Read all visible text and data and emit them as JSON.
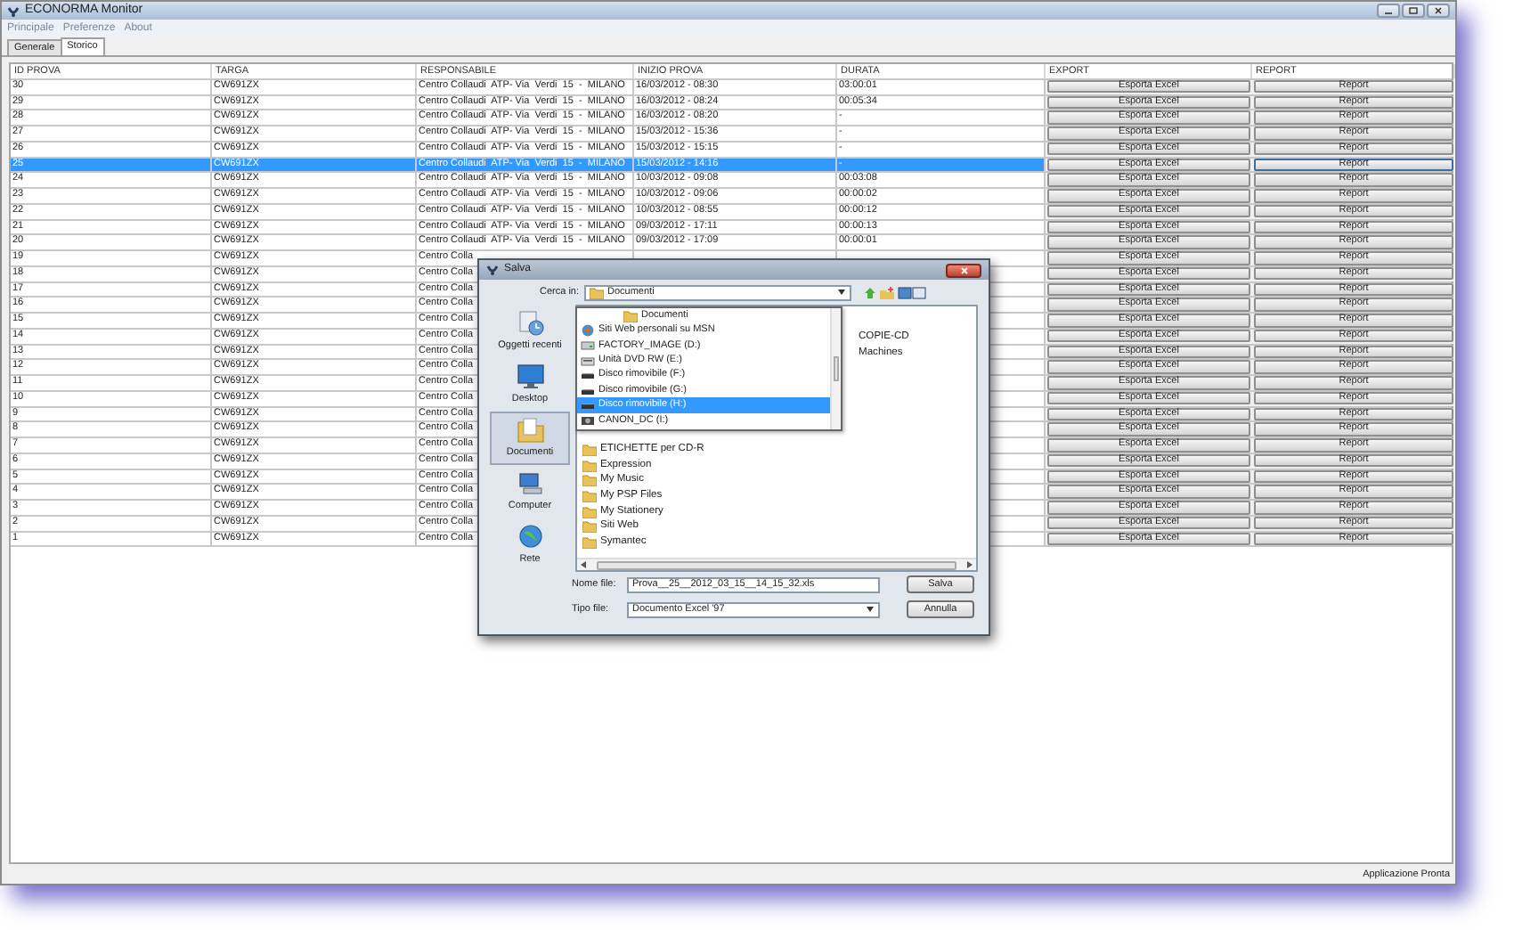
{
  "window": {
    "title": "ECONORMA Monitor"
  },
  "menu": [
    "Principale",
    "Preferenze",
    "About"
  ],
  "tabs": [
    {
      "label": "Generale",
      "selected": false
    },
    {
      "label": "Storico",
      "selected": true
    }
  ],
  "table": {
    "columns": [
      "ID PROVA",
      "TARGA",
      "RESPONSABILE",
      "INIZIO PROVA",
      "DURATA",
      "EXPORT",
      "REPORT"
    ],
    "rows": [
      {
        "id": "30",
        "targa": "CW691ZX",
        "responsabile": "Centro Collaudi  ATP- Via  Verdi  15  -  MILANO",
        "inizio": "16/03/2012 - 08:30",
        "durata": "03:00:01",
        "export": "Esporta Excel",
        "report": "Report",
        "selected": false
      },
      {
        "id": "29",
        "targa": "CW691ZX",
        "responsabile": "Centro Collaudi  ATP- Via  Verdi  15  -  MILANO",
        "inizio": "16/03/2012 - 08:24",
        "durata": "00:05:34",
        "export": "Esporta Excel",
        "report": "Report",
        "selected": false
      },
      {
        "id": "28",
        "targa": "CW691ZX",
        "responsabile": "Centro Collaudi  ATP- Via  Verdi  15  -  MILANO",
        "inizio": "16/03/2012 - 08:20",
        "durata": "-",
        "export": "Esporta Excel",
        "report": "Report",
        "selected": false
      },
      {
        "id": "27",
        "targa": "CW691ZX",
        "responsabile": "Centro Collaudi  ATP- Via  Verdi  15  -  MILANO",
        "inizio": "15/03/2012 - 15:36",
        "durata": "-",
        "export": "Esporta Excel",
        "report": "Report",
        "selected": false
      },
      {
        "id": "26",
        "targa": "CW691ZX",
        "responsabile": "Centro Collaudi  ATP- Via  Verdi  15  -  MILANO",
        "inizio": "15/03/2012 - 15:15",
        "durata": "-",
        "export": "Esporta Excel",
        "report": "Report",
        "selected": false
      },
      {
        "id": "25",
        "targa": "CW691ZX",
        "responsabile": "Centro Collaudi  ATP- Via  Verdi  15  -  MILANO",
        "inizio": "15/03/2012 - 14:16",
        "durata": "-",
        "export": "Esporta Excel",
        "report": "Report",
        "selected": true
      },
      {
        "id": "24",
        "targa": "CW691ZX",
        "responsabile": "Centro Collaudi  ATP- Via  Verdi  15  -  MILANO",
        "inizio": "10/03/2012 - 09:08",
        "durata": "00:03:08",
        "export": "Esporta Excel",
        "report": "Report",
        "selected": false
      },
      {
        "id": "23",
        "targa": "CW691ZX",
        "responsabile": "Centro Collaudi  ATP- Via  Verdi  15  -  MILANO",
        "inizio": "10/03/2012 - 09:06",
        "durata": "00:00:02",
        "export": "Esporta Excel",
        "report": "Report",
        "selected": false
      },
      {
        "id": "22",
        "targa": "CW691ZX",
        "responsabile": "Centro Collaudi  ATP- Via  Verdi  15  -  MILANO",
        "inizio": "10/03/2012 - 08:55",
        "durata": "00:00:12",
        "export": "Esporta Excel",
        "report": "Report",
        "selected": false
      },
      {
        "id": "21",
        "targa": "CW691ZX",
        "responsabile": "Centro Collaudi  ATP- Via  Verdi  15  -  MILANO",
        "inizio": "09/03/2012 - 17:11",
        "durata": "00:00:13",
        "export": "Esporta Excel",
        "report": "Report",
        "selected": false
      },
      {
        "id": "20",
        "targa": "CW691ZX",
        "responsabile": "Centro Collaudi  ATP- Via  Verdi  15  -  MILANO",
        "inizio": "09/03/2012 - 17:09",
        "durata": "00:00:01",
        "export": "Esporta Excel",
        "report": "Report",
        "selected": false
      },
      {
        "id": "19",
        "targa": "CW691ZX",
        "responsabile": "Centro Colla",
        "export": "Esporta Excel",
        "report": "Report",
        "selected": false
      },
      {
        "id": "18",
        "targa": "CW691ZX",
        "responsabile": "Centro Colla",
        "export": "Esporta Excel",
        "report": "Report",
        "selected": false
      },
      {
        "id": "17",
        "targa": "CW691ZX",
        "responsabile": "Centro Colla",
        "export": "Esporta Excel",
        "report": "Report",
        "selected": false
      },
      {
        "id": "16",
        "targa": "CW691ZX",
        "responsabile": "Centro Colla",
        "export": "Esporta Excel",
        "report": "Report",
        "selected": false
      },
      {
        "id": "15",
        "targa": "CW691ZX",
        "responsabile": "Centro Colla",
        "export": "Esporta Excel",
        "report": "Report",
        "selected": false
      },
      {
        "id": "14",
        "targa": "CW691ZX",
        "responsabile": "Centro Colla",
        "export": "Esporta Excel",
        "report": "Report",
        "selected": false
      },
      {
        "id": "13",
        "targa": "CW691ZX",
        "responsabile": "Centro Colla",
        "export": "Esporta Excel",
        "report": "Report",
        "selected": false
      },
      {
        "id": "12",
        "targa": "CW691ZX",
        "responsabile": "Centro Colla",
        "export": "Esporta Excel",
        "report": "Report",
        "selected": false
      },
      {
        "id": "11",
        "targa": "CW691ZX",
        "responsabile": "Centro Colla",
        "export": "Esporta Excel",
        "report": "Report",
        "selected": false
      },
      {
        "id": "10",
        "targa": "CW691ZX",
        "responsabile": "Centro Colla",
        "export": "Esporta Excel",
        "report": "Report",
        "selected": false
      },
      {
        "id": "9",
        "targa": "CW691ZX",
        "responsabile": "Centro Colla",
        "export": "Esporta Excel",
        "report": "Report",
        "selected": false
      },
      {
        "id": "8",
        "targa": "CW691ZX",
        "responsabile": "Centro Colla",
        "export": "Esporta Excel",
        "report": "Report",
        "selected": false
      },
      {
        "id": "7",
        "targa": "CW691ZX",
        "responsabile": "Centro Colla",
        "export": "Esporta Excel",
        "report": "Report",
        "selected": false
      },
      {
        "id": "6",
        "targa": "CW691ZX",
        "responsabile": "Centro Colla",
        "export": "Esporta Excel",
        "report": "Report",
        "selected": false
      },
      {
        "id": "5",
        "targa": "CW691ZX",
        "responsabile": "Centro Colla",
        "export": "Esporta Excel",
        "report": "Report",
        "selected": false
      },
      {
        "id": "4",
        "targa": "CW691ZX",
        "responsabile": "Centro Colla",
        "export": "Esporta Excel",
        "report": "Report",
        "selected": false
      },
      {
        "id": "3",
        "targa": "CW691ZX",
        "responsabile": "Centro Colla",
        "export": "Esporta Excel",
        "report": "Report",
        "selected": false
      },
      {
        "id": "2",
        "targa": "CW691ZX",
        "responsabile": "Centro Colla",
        "export": "Esporta Excel",
        "report": "Report",
        "selected": false
      },
      {
        "id": "1",
        "targa": "CW691ZX",
        "responsabile": "Centro Colla",
        "export": "Esporta Excel",
        "report": "Report",
        "selected": false
      }
    ]
  },
  "status_bar": "Applicazione Pronta",
  "save_dialog": {
    "title": "Salva",
    "look_in_label": "Cerca in:",
    "look_in_value": "Documenti",
    "places": [
      {
        "label": "Oggetti recenti",
        "kind": "recent",
        "selected": false
      },
      {
        "label": "Desktop",
        "kind": "desktop",
        "selected": false
      },
      {
        "label": "Documenti",
        "kind": "documents",
        "selected": true
      },
      {
        "label": "Computer",
        "kind": "computer",
        "selected": false
      },
      {
        "label": "Rete",
        "kind": "network",
        "selected": false
      }
    ],
    "dropdown": [
      {
        "label": "Documenti",
        "kind": "subfolder",
        "selected": false
      },
      {
        "label": "Siti Web personali su MSN",
        "kind": "web",
        "selected": false
      },
      {
        "label": "FACTORY_IMAGE (D:)",
        "kind": "drive",
        "selected": false
      },
      {
        "label": "Unità DVD RW (E:)",
        "kind": "dvd",
        "selected": false
      },
      {
        "label": "Disco rimovibile (F:)",
        "kind": "removable",
        "selected": false
      },
      {
        "label": "Disco rimovibile (G:)",
        "kind": "removable",
        "selected": false
      },
      {
        "label": "Disco rimovibile (H:)",
        "kind": "removable",
        "selected": true
      },
      {
        "label": "CANON_DC (I:)",
        "kind": "camera",
        "selected": false
      }
    ],
    "files_column_1": [
      "ETICHETTE per CD-R",
      "Expression",
      "My Music",
      "My PSP Files",
      "My Stationery",
      "Siti Web",
      "Symantec"
    ],
    "files_column_2": [
      "COPIE-CD",
      "Machines"
    ],
    "file_name_label": "Nome file:",
    "file_name": "Prova__25__2012_03_15__14_15_32.xls",
    "file_type_label": "Tipo file:",
    "file_type": "Documento Excel '97",
    "save_button": "Salva",
    "cancel_button": "Annulla"
  }
}
